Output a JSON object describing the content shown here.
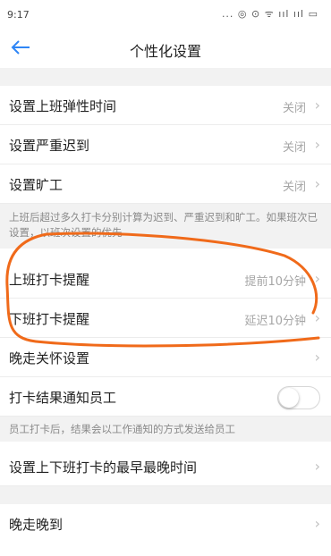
{
  "status_bar": {
    "time": "9:17",
    "icons": "... ◎ ⊙ ᯤ ııl ııl ▭"
  },
  "header": {
    "title": "个性化设置"
  },
  "settings": {
    "flex_time": {
      "label": "设置上班弹性时间",
      "value": "关闭"
    },
    "serious_late": {
      "label": "设置严重迟到",
      "value": "关闭"
    },
    "absent": {
      "label": "设置旷工",
      "value": "关闭"
    },
    "hint_lateness": "上班后超过多久打卡分别计算为迟到、严重迟到和旷工。如果班次已设置，以班次设置的优先",
    "checkin_reminder": {
      "label": "上班打卡提醒",
      "value": "提前10分钟"
    },
    "checkout_reminder": {
      "label": "下班打卡提醒",
      "value": "延迟10分钟"
    },
    "late_care": {
      "label": "晚走关怀设置"
    },
    "notify_result": {
      "label": "打卡结果通知员工",
      "enabled": false
    },
    "hint_notify": "员工打卡后，结果会以工作通知的方式发送给员工",
    "earliest_latest": {
      "label": "设置上下班打卡的最早最晚时间"
    },
    "late_leave_late_arrive": {
      "label": "晚走晚到"
    }
  },
  "colors": {
    "accent": "#2f86f6",
    "annotation": "#f06a1a"
  }
}
